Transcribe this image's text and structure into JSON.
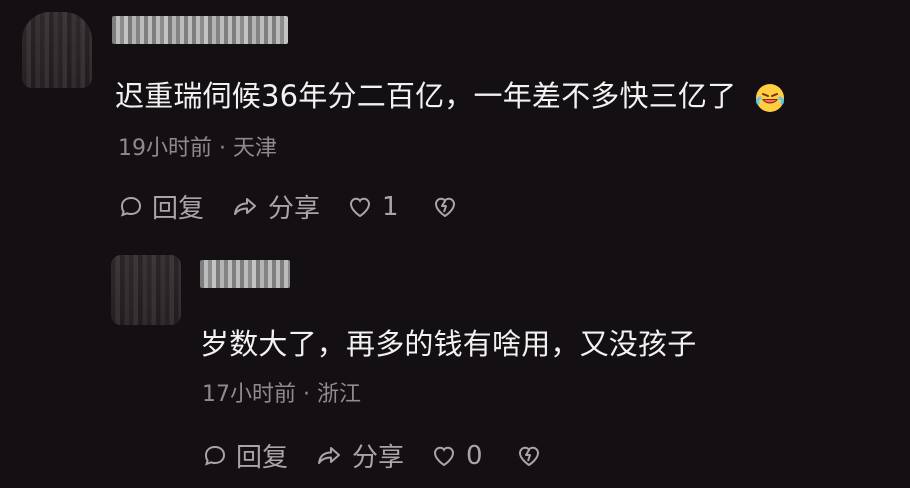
{
  "comments": [
    {
      "text": "迟重瑞伺候36年分二百亿，一年差不多快三亿了",
      "time_location": "19小时前 · 天津",
      "actions": {
        "reply": "回复",
        "share": "分享",
        "likes": "1"
      }
    },
    {
      "text": "岁数大了，再多的钱有啥用，又没孩子",
      "time_location": "17小时前 · 浙江",
      "actions": {
        "reply": "回复",
        "share": "分享",
        "likes": "0"
      }
    }
  ],
  "icons": {
    "reply": "speech-bubble-icon",
    "share": "share-arrow-icon",
    "like": "heart-icon",
    "dislike": "broken-heart-icon",
    "emoji": "laughing-tears-emoji-icon"
  }
}
